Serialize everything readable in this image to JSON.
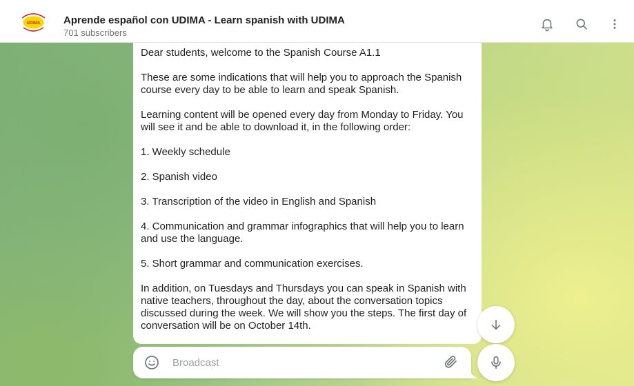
{
  "header": {
    "channel_name": "Aprende español con UDIMA - Learn spanish with UDIMA",
    "subscribers": "701 subscribers",
    "avatar_text": "UDIMA",
    "icons": [
      "bell-icon",
      "search-icon",
      "more-vertical-icon"
    ]
  },
  "message": {
    "paragraphs": [
      "Dear students, welcome to the Spanish Course A1.1",
      "These are some indications that will help you to approach the Spanish course every day to be able to learn and speak Spanish.",
      "Learning content will be opened every day from Monday to Friday. You will see it and be able to download it, in the following order:",
      "1. Weekly schedule",
      "2. Spanish video",
      "3. Transcription of the video in English and Spanish",
      "4. Communication and grammar infographics that will help you to learn and use the language.",
      "5. Short grammar and communication exercises.",
      "In addition, on Tuesdays and Thursdays you can speak in Spanish with native teachers, throughout the day, about the conversation topics discussed during the week. We will show you the steps. The first day of conversation will be on October 14th."
    ]
  },
  "composer": {
    "placeholder": "Broadcast",
    "value": "",
    "icons": [
      "smile-icon",
      "paperclip-icon",
      "microphone-icon"
    ]
  },
  "scroll_down": {
    "icon": "arrow-down-icon"
  },
  "colors": {
    "header_bg": "#ffffff",
    "bubble_bg": "#ffffff",
    "icon_gray": "#707579",
    "avatar_yellow": "#f5d800",
    "avatar_red": "#d9271d"
  }
}
